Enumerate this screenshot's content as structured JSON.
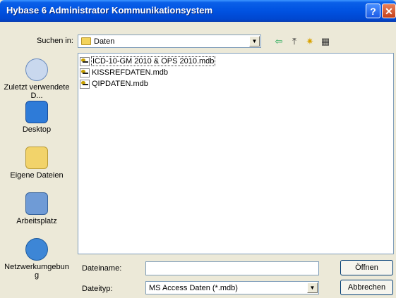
{
  "window": {
    "title": "Hybase 6 Administrator Kommunikationsystem",
    "help": "?",
    "close": "✕"
  },
  "lookin": {
    "label": "Suchen in:",
    "value": "Daten"
  },
  "toolbar": {
    "back": "⇦",
    "up": "⤒",
    "newfolder": "✷",
    "views": "▦"
  },
  "places": [
    {
      "label": "Zuletzt verwendete D..."
    },
    {
      "label": "Desktop"
    },
    {
      "label": "Eigene Dateien"
    },
    {
      "label": "Arbeitsplatz"
    },
    {
      "label": "Netzwerkumgebung"
    }
  ],
  "files": [
    {
      "name": "ICD-10-GM 2010 & OPS 2010.mdb"
    },
    {
      "name": "KISSREFDATEN.mdb"
    },
    {
      "name": "QIPDATEN.mdb"
    }
  ],
  "filename": {
    "label": "Dateiname:",
    "value": ""
  },
  "filetype": {
    "label": "Dateityp:",
    "value": "MS Access Daten (*.mdb)"
  },
  "buttons": {
    "open": "Öffnen",
    "cancel": "Abbrechen"
  }
}
